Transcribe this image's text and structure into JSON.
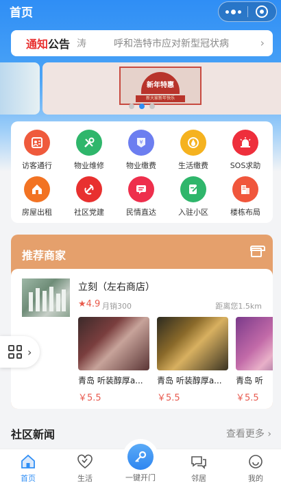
{
  "header": {
    "title": "首页"
  },
  "notice": {
    "label_red": "通知",
    "label_black": "公告",
    "prev_text": "涛",
    "text": "呼和浩特市应对新型冠状病"
  },
  "banner": {
    "badge": "新年特惠",
    "ribbon": "新大家新年快乐",
    "active_index": 1
  },
  "services": [
    {
      "label": "访客通行",
      "icon": "visitor-icon",
      "color": "#ef5a3c"
    },
    {
      "label": "物业维修",
      "icon": "wrench-icon",
      "color": "#2fb66b"
    },
    {
      "label": "物业缴费",
      "icon": "yen-icon",
      "color": "#6c7ef0"
    },
    {
      "label": "生活缴费",
      "icon": "drop-icon",
      "color": "#f5b21f"
    },
    {
      "label": "SOS求助",
      "icon": "alarm-icon",
      "color": "#ee2f3c"
    },
    {
      "label": "房屋出租",
      "icon": "house-icon",
      "color": "#f27323"
    },
    {
      "label": "社区党建",
      "icon": "party-icon",
      "color": "#e8302f"
    },
    {
      "label": "民情直达",
      "icon": "message-icon",
      "color": "#ee2f4c"
    },
    {
      "label": "入驻小区",
      "icon": "edit-icon",
      "color": "#2fb66b"
    },
    {
      "label": "楼栋布局",
      "icon": "building-icon",
      "color": "#f0563c"
    }
  ],
  "merchant": {
    "section_title": "推荐商家",
    "name": "立刻（左右商店）",
    "rating": "4.9",
    "sales": "月销300",
    "distance": "距离您1.5km",
    "products": [
      {
        "name": "青岛 听装醇厚a...",
        "price": "￥5.5"
      },
      {
        "name": "青岛 听装醇厚a...",
        "price": "￥5.5"
      },
      {
        "name": "青岛 听",
        "price": "￥5.5"
      }
    ]
  },
  "news": {
    "title": "社区新闻",
    "more": "查看更多"
  },
  "tabbar": {
    "home": "首页",
    "life": "生活",
    "key": "一键开门",
    "neighbor": "邻居",
    "mine": "我的"
  },
  "colors": {
    "primary": "#2f8ef5",
    "merchant_header": "#e5a06c",
    "price": "#e85a4f"
  }
}
